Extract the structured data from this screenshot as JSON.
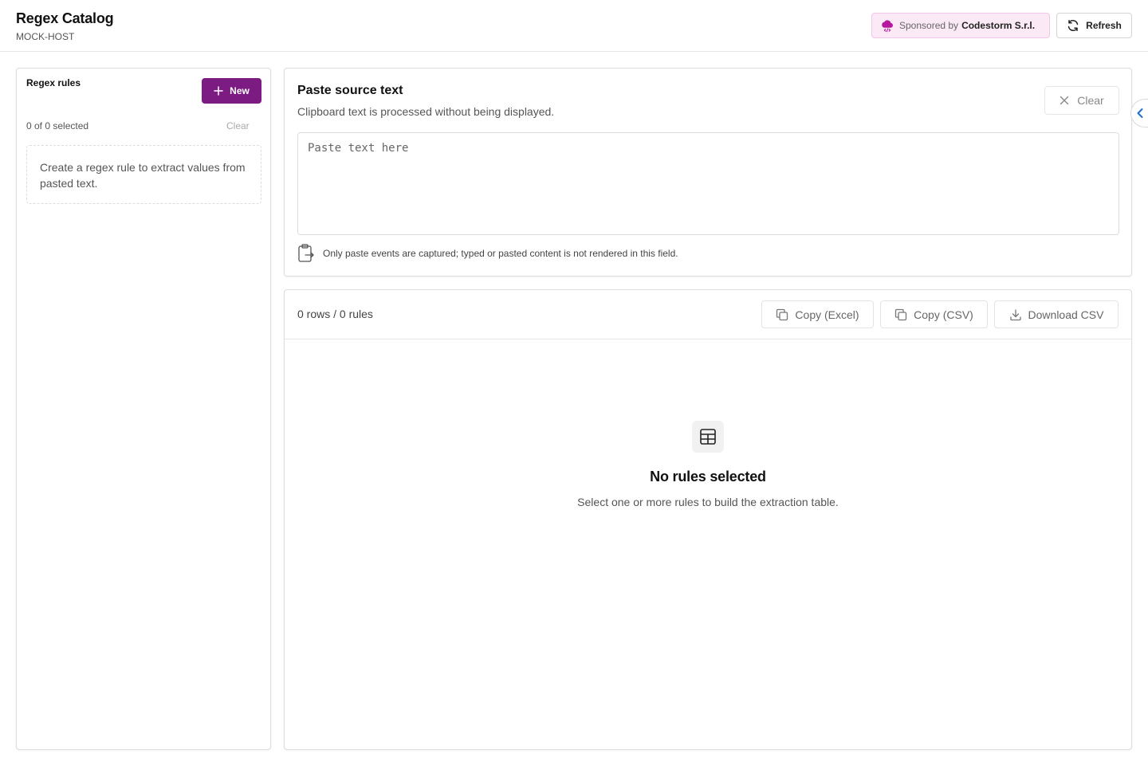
{
  "header": {
    "title": "Regex Catalog",
    "subtitle": "MOCK-HOST",
    "sponsor_prefix": "Sponsored by",
    "sponsor_name": "Codestorm S.r.l.",
    "refresh_label": "Refresh"
  },
  "rules_panel": {
    "title": "Regex rules",
    "new_label": "New",
    "selected_count": "0 of 0 selected",
    "clear_label": "Clear",
    "empty_message": "Create a regex rule to extract values from pasted text."
  },
  "source_panel": {
    "title": "Paste source text",
    "description": "Clipboard text is processed without being displayed.",
    "clear_label": "Clear",
    "textarea_placeholder": "Paste text here",
    "note": "Only paste events are captured; typed or pasted content is not rendered in this field."
  },
  "results_panel": {
    "count": "0 rows / 0 rules",
    "copy_excel_label": "Copy (Excel)",
    "copy_csv_label": "Copy (CSV)",
    "download_csv_label": "Download CSV",
    "empty_title": "No rules selected",
    "empty_description": "Select one or more rules to build the extraction table."
  },
  "colors": {
    "accent": "#7c1c82",
    "sponsor_bg": "#fbeaf6",
    "sponsor_icon": "#b5179e",
    "collapse_arrow": "#1f6fd1"
  },
  "icons": {
    "sponsor": "cloud-code-icon",
    "refresh": "refresh-icon",
    "new": "plus-icon",
    "clear": "close-icon",
    "paste_note": "clipboard-icon",
    "copy": "copy-icon",
    "download": "download-icon",
    "empty_state": "table-icon",
    "collapse": "chevron-left-icon"
  }
}
